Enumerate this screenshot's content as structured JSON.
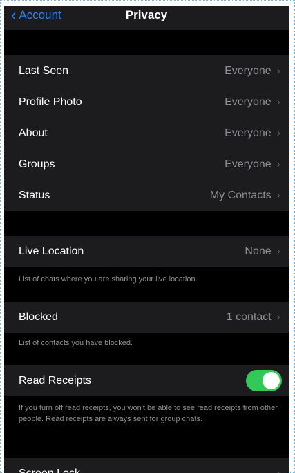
{
  "navbar": {
    "back_label": "Account",
    "title": "Privacy"
  },
  "rows": {
    "last_seen": {
      "label": "Last Seen",
      "value": "Everyone"
    },
    "profile_photo": {
      "label": "Profile Photo",
      "value": "Everyone"
    },
    "about": {
      "label": "About",
      "value": "Everyone"
    },
    "groups": {
      "label": "Groups",
      "value": "Everyone"
    },
    "status": {
      "label": "Status",
      "value": "My Contacts"
    },
    "live_location": {
      "label": "Live Location",
      "value": "None",
      "footer": "List of chats where you are sharing your live location."
    },
    "blocked": {
      "label": "Blocked",
      "value": "1 contact",
      "footer": "List of contacts you have blocked."
    },
    "read_receipts": {
      "label": "Read Receipts",
      "enabled": true,
      "footer": "If you turn off read receipts, you won't be able to see read receipts from other people. Read receipts are always sent for group chats."
    },
    "screen_lock": {
      "label": "Screen Lock"
    }
  },
  "colors": {
    "accent": "#2f7ff0",
    "toggle_on": "#34c759",
    "cell_background": "#1c1c1e",
    "secondary_text": "#8e8e93"
  },
  "icons": {
    "back": "chevron-left-icon",
    "disclosure": "chevron-right-icon"
  }
}
